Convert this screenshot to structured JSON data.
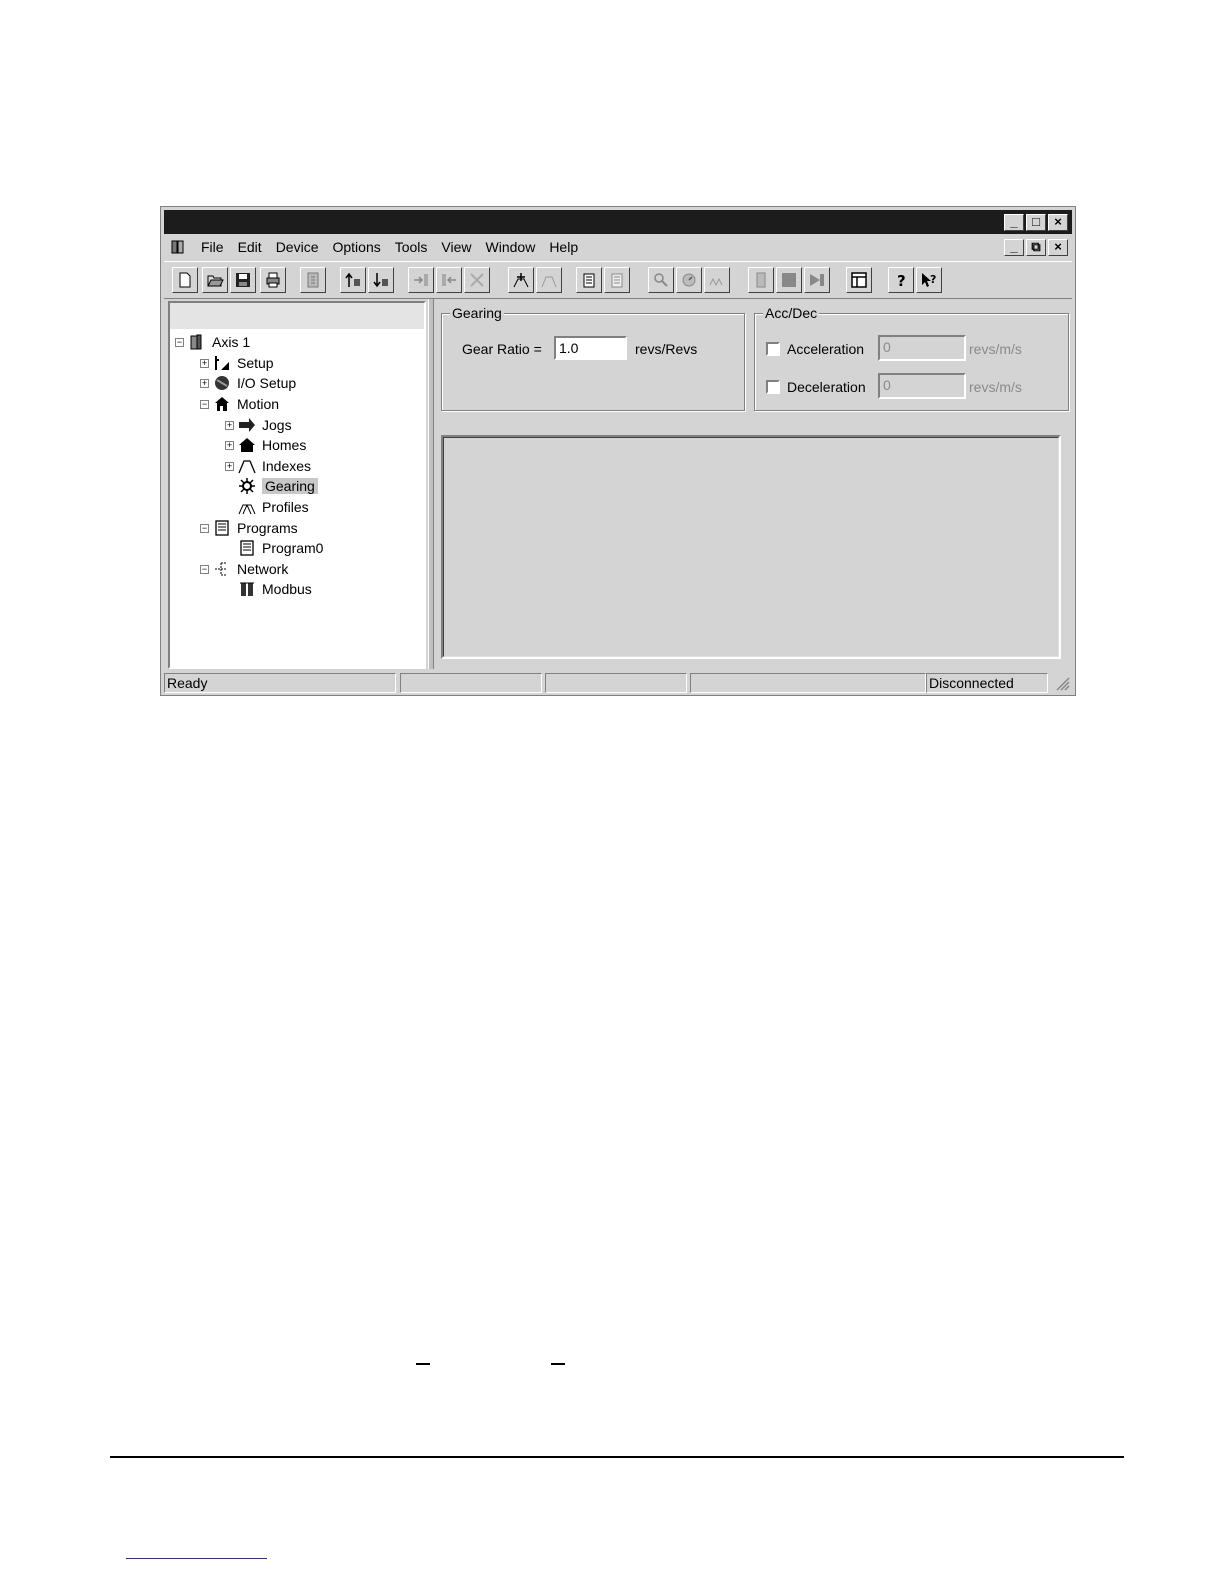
{
  "menu": [
    "File",
    "Edit",
    "Device",
    "Options",
    "Tools",
    "View",
    "Window",
    "Help"
  ],
  "window_controls": {
    "minimize": "_",
    "maximize": "□",
    "close": "×",
    "restore": "⧉"
  },
  "tree": {
    "root": "Axis 1",
    "items": [
      {
        "label": "Setup",
        "expander": "+"
      },
      {
        "label": "I/O Setup",
        "expander": "+"
      },
      {
        "label": "Motion",
        "expander": "−"
      },
      {
        "label": "Jogs",
        "expander": "+"
      },
      {
        "label": "Homes",
        "expander": "+"
      },
      {
        "label": "Indexes",
        "expander": "+"
      },
      {
        "label": "Gearing",
        "expander": ""
      },
      {
        "label": "Profiles",
        "expander": ""
      },
      {
        "label": "Programs",
        "expander": "−"
      },
      {
        "label": "Program0",
        "expander": ""
      },
      {
        "label": "Network",
        "expander": "−"
      },
      {
        "label": "Modbus",
        "expander": ""
      }
    ],
    "selected": "Gearing"
  },
  "gearing": {
    "title": "Gearing",
    "ratio_label": "Gear Ratio =",
    "ratio_value": "1.0",
    "ratio_units": "revs/Revs"
  },
  "accdec": {
    "title": "Acc/Dec",
    "acceleration_label": "Acceleration",
    "acceleration_value": "0",
    "acceleration_units": "revs/m/s",
    "deceleration_label": "Deceleration",
    "deceleration_value": "0",
    "deceleration_units": "revs/m/s"
  },
  "status": {
    "left": "Ready",
    "connection": "Disconnected"
  }
}
